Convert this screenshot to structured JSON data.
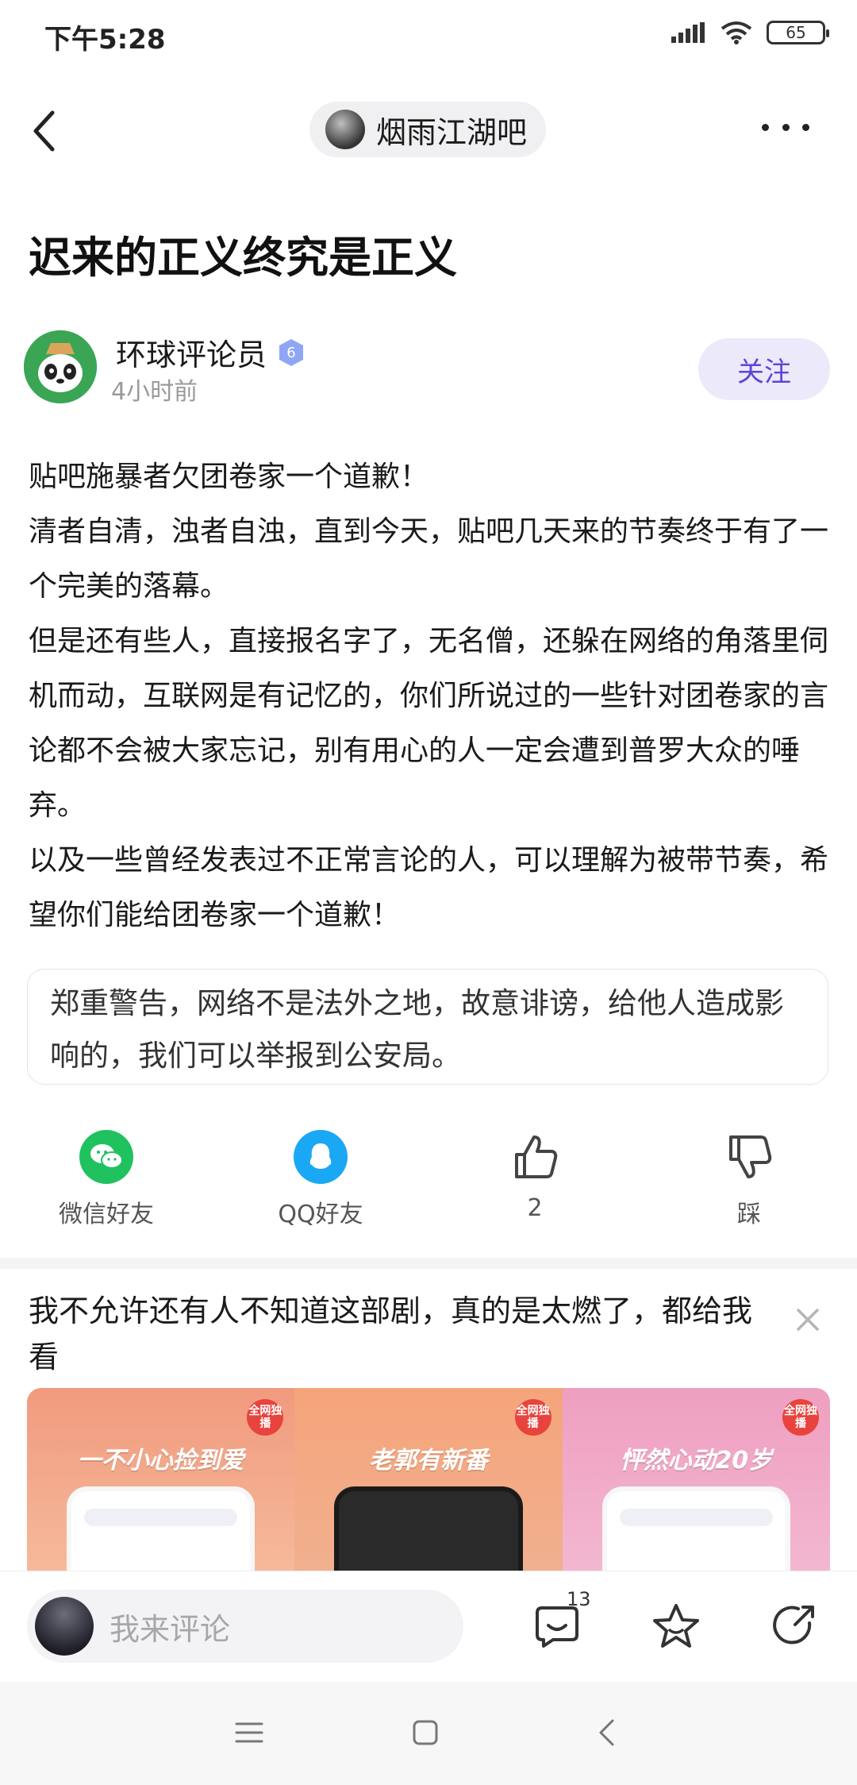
{
  "status_bar": {
    "time": "下午5:28",
    "battery": "65"
  },
  "nav": {
    "forum_name": "烟雨江湖吧"
  },
  "post": {
    "title": "迟来的正义终究是正义",
    "author": {
      "name": "环球评论员",
      "level": "6",
      "time": "4小时前"
    },
    "follow_label": "关注",
    "paragraphs": [
      "贴吧施暴者欠团卷家一个道歉！",
      "清者自清，浊者自浊，直到今天，贴吧几天来的节奏终于有了一个完美的落幕。",
      "但是还有些人，直接报名字了，无名僧，还躲在网络的角落里伺机而动，互联网是有记忆的，你们所说过的一些针对团卷家的言论都不会被大家忘记，别有用心的人一定会遭到普罗大众的唾弃。",
      "以及一些曾经发表过不正常言论的人，可以理解为被带节奏，希望你们能给团卷家一个道歉！"
    ],
    "quote": "郑重警告，网络不是法外之地，故意诽谤，给他人造成影响的，我们可以举报到公安局。"
  },
  "actions": {
    "wechat_label": "微信好友",
    "qq_label": "QQ好友",
    "like_count": "2",
    "dislike_label": "踩"
  },
  "ad": {
    "title": "我不允许还有人不知道这部剧，真的是太燃了，都给我看",
    "panels": [
      {
        "tag": "全网独播",
        "caption": "一不小心捡到爱"
      },
      {
        "tag": "全网独播",
        "caption": "老郭有新番"
      },
      {
        "tag": "全网独播",
        "caption": "怦然心动20岁"
      }
    ]
  },
  "comment_bar": {
    "placeholder": "我来评论",
    "comment_count": "13"
  },
  "colors": {
    "accent": "#5a46d6",
    "follow_bg": "#ece9fb",
    "wechat": "#1fc25f",
    "qq": "#1aa8f5"
  }
}
